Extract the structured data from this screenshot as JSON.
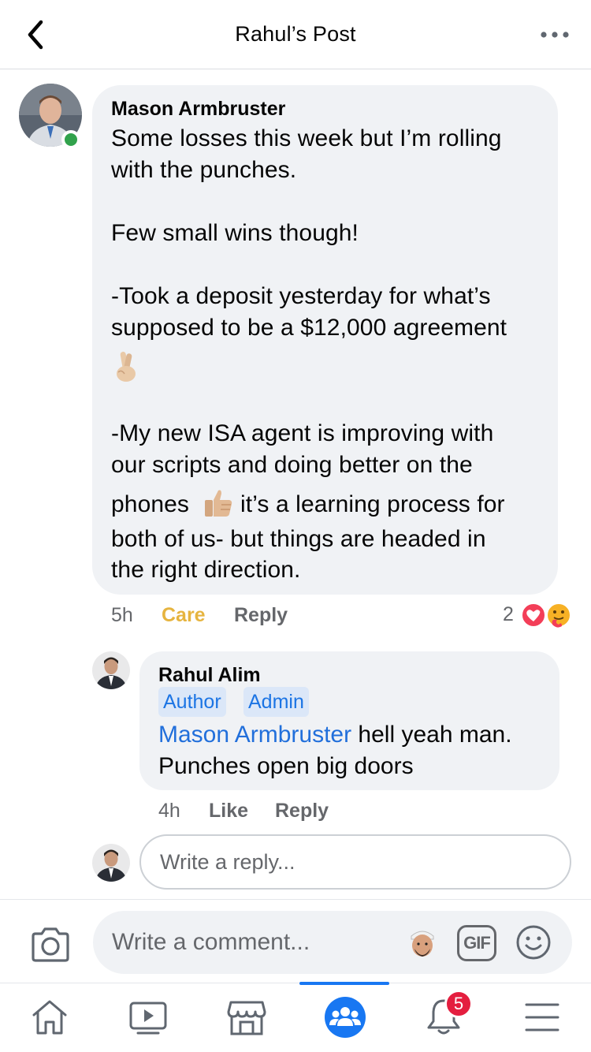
{
  "header": {
    "title": "Rahul’s Post"
  },
  "main_comment": {
    "author": "Mason Armbruster",
    "lines": {
      "l1": "Some losses this week but I’m rolling",
      "l2": "with the punches.",
      "l3": "Few small wins though!",
      "l4": "-Took a deposit yesterday for what’s",
      "l5": "supposed to be a $12,000 agreement",
      "l6": "-My new ISA agent is improving with",
      "l7": "our scripts and doing better on the",
      "l8a": "phones",
      "l8b": "it’s a learning process for",
      "l9": "both of us- but things are headed in",
      "l10": "the right direction."
    },
    "time": "5h",
    "reaction_label": "Care",
    "reply_label": "Reply",
    "reaction_count": "2",
    "online": true
  },
  "reply_comment": {
    "author": "Rahul Alim",
    "badges": [
      "Author",
      "Admin"
    ],
    "mention": "Mason Armbruster",
    "text_after_mention": " hell yeah man.",
    "text_line2": "Punches open big doors",
    "time": "4h",
    "like_label": "Like",
    "reply_label": "Reply"
  },
  "reply_input": {
    "placeholder": "Write a reply..."
  },
  "comment_bar": {
    "placeholder": "Write a comment...",
    "gif_label": "GIF"
  },
  "bottom_nav": {
    "items": [
      "home-icon",
      "watch-icon",
      "marketplace-icon",
      "groups-icon",
      "notifications-icon",
      "menu-icon"
    ],
    "active": "groups-icon",
    "notification_count": "5"
  },
  "colors": {
    "accent": "#1877f2",
    "care": "#e6b43f",
    "mention": "#216fdb",
    "online": "#31a24c",
    "badge_bg": "#dbe7f8",
    "notif_badge": "#e41e3f"
  }
}
